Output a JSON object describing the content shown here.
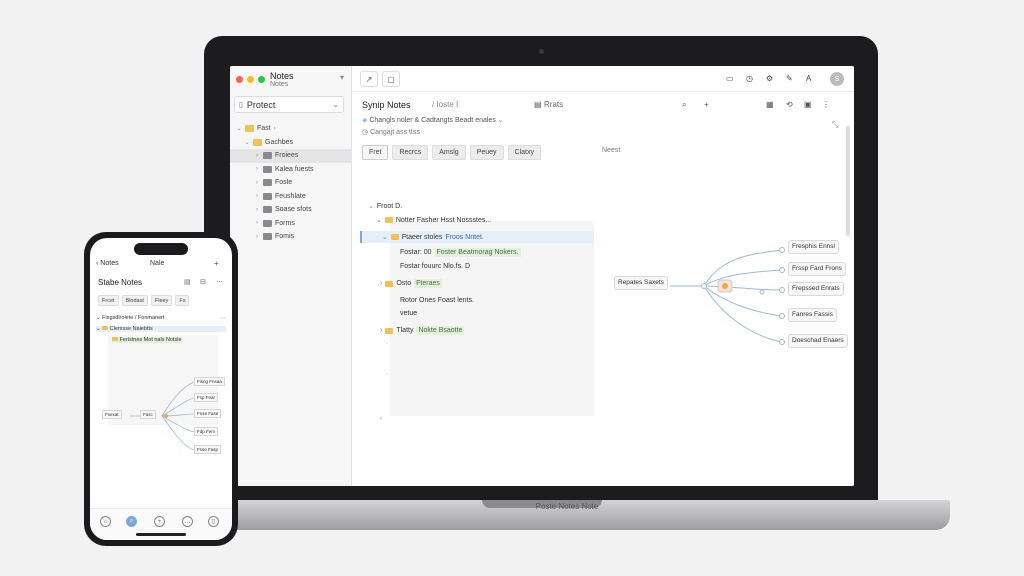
{
  "laptop": {
    "brand_label": "Poste Notes Note",
    "window": {
      "app_name": "Notes",
      "app_sub": "Notes",
      "colors": [
        "#ff5f57",
        "#febc2e",
        "#28c840"
      ]
    },
    "sidebar": {
      "project_label": "Protect",
      "tree": [
        {
          "label": "Fast",
          "icon": "folder-icon",
          "color": "yellow",
          "expanded": true,
          "selected": false
        },
        {
          "label": "Gachbes",
          "icon": "folder-icon",
          "color": "yellow",
          "expanded": true,
          "selected": false
        },
        {
          "label": "Froiees",
          "icon": "folder-icon",
          "color": "gray",
          "expanded": false,
          "selected": true
        },
        {
          "label": "Kalea fuests",
          "icon": "folder-icon",
          "color": "gray",
          "expanded": false,
          "selected": false
        },
        {
          "label": "Fosle",
          "icon": "folder-icon",
          "color": "gray",
          "expanded": false,
          "selected": false
        },
        {
          "label": "Feushlate",
          "icon": "folder-icon",
          "color": "gray",
          "expanded": false,
          "selected": false
        },
        {
          "label": "Soase sfots",
          "icon": "folder-icon",
          "color": "gray",
          "expanded": false,
          "selected": false
        },
        {
          "label": "Forms",
          "icon": "folder-icon",
          "color": "gray",
          "expanded": false,
          "selected": false
        },
        {
          "label": "Fomis",
          "icon": "folder-icon",
          "color": "gray",
          "expanded": false,
          "selected": false
        }
      ]
    },
    "toolbar": {
      "nav_icon": "arrow-icon",
      "nav_icon2": "square-icon",
      "right_icons": [
        "chat-icon",
        "history-icon",
        "settings-icon",
        "edit-icon",
        "text-icon"
      ],
      "avatar_initial": "S"
    },
    "doc": {
      "title": "Synip Notes",
      "crumb": "/ Ioste I",
      "count": "Rrats",
      "meta1": "Changls noler & Cadtangts Beadt enales",
      "meta2": "Cangajt ass ttss",
      "tabs": [
        "Fret",
        "Recrcs",
        "Amslg",
        "Peuey",
        "Clatxy"
      ],
      "tab_more": "Neest",
      "outline": {
        "root": "Froot D.",
        "section": "Notter Fasher Hsst Nossstes...",
        "item1_label": "Ftaeer stoles",
        "item1_tag": "Froos Nntet.",
        "item2_a": "Fostar: 00",
        "item2_tag": "Foster Beatmorag Nokers.",
        "item3": "Fostar fouurc Nlo.fs. D",
        "item4_label": "Osto",
        "item4_tag": "Fteraes",
        "item5": "Rotor Ones Foast lents.",
        "item5b": "vetue",
        "item6_label": "Tlatty",
        "item6_tag": "Nokte Bsaotte"
      },
      "mindmap": {
        "center": "Repates Saxets",
        "branches": [
          "Fresphis Ennsl",
          "Frssp Fard Frons",
          "Frepssed Enrats",
          "Fanres Fassis",
          "Doeschad Enaers"
        ]
      }
    }
  },
  "phone": {
    "back_label": "Notes",
    "top_title": "Nale",
    "heading": "Stabe Notes",
    "tabs": [
      "Frcet",
      "Blodast",
      "Fleey",
      "Fs"
    ],
    "outline": {
      "root": "Fisgsdlrolete / Fonmanert",
      "section": "Clemsse Naiebtts",
      "item": "Feristnes Mot nals Notsle"
    },
    "mindmap": {
      "center": "Fsexat",
      "branches": [
        "Fisng Fnsaa",
        "Fsp Fear",
        "Fnse Fase",
        "Fdp Fem",
        "Fsse Fasp"
      ],
      "hub": "Fasc"
    },
    "tabbar": [
      "home-icon",
      "search-icon",
      "add-icon",
      "chat-icon",
      "profile-icon"
    ]
  }
}
